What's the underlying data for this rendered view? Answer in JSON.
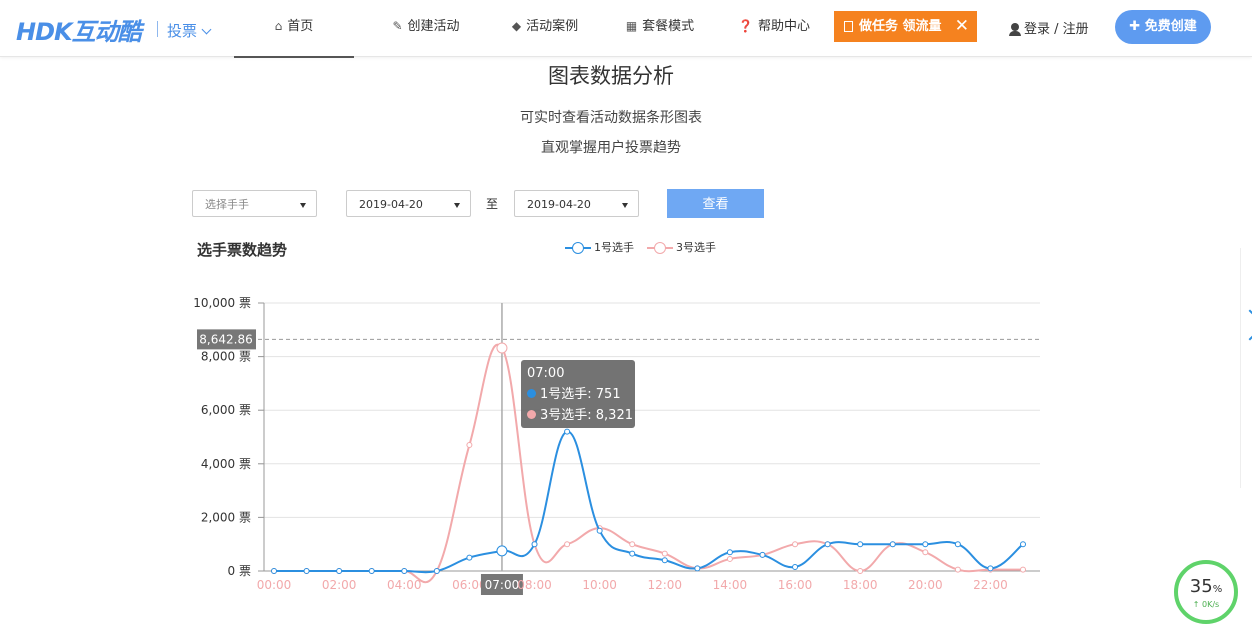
{
  "header": {
    "logo": "HDK互动酷",
    "module": "投票",
    "nav": [
      {
        "label": "首页",
        "icon": "home-icon"
      },
      {
        "label": "创建活动",
        "icon": "edit-icon"
      },
      {
        "label": "活动案例",
        "icon": "cube-icon"
      },
      {
        "label": "套餐模式",
        "icon": "grid-icon"
      },
      {
        "label": "帮助中心",
        "icon": "question-icon"
      }
    ],
    "task_button": "做任务 领流量",
    "login": "登录 / 注册",
    "free_create": "免费创建"
  },
  "section": {
    "title": "图表数据分析",
    "subtitle1": "可实时查看活动数据条形图表",
    "subtitle2": "直观掌握用户投票趋势"
  },
  "filters": {
    "player_placeholder": "选择手手",
    "start_date": "2019-04-20",
    "to_label": "至",
    "end_date": "2019-04-20",
    "query_button": "查看"
  },
  "chart_title": "选手票数趋势",
  "tooltip": {
    "time": "07:00",
    "row1": "1号选手: 751",
    "row2": "3号选手: 8,321"
  },
  "progress": {
    "value": "35",
    "unit": "%",
    "sub": "↑ 0K/s"
  },
  "colors": {
    "series1": "#2b8fe0",
    "series3": "#f2a9ab",
    "accent": "#5e9bf0",
    "task": "#f5821f"
  },
  "chart_data": {
    "type": "line",
    "x": [
      "00:00",
      "01:00",
      "02:00",
      "03:00",
      "04:00",
      "05:00",
      "06:00",
      "07:00",
      "08:00",
      "09:00",
      "10:00",
      "11:00",
      "12:00",
      "13:00",
      "14:00",
      "15:00",
      "16:00",
      "17:00",
      "18:00",
      "19:00",
      "20:00",
      "21:00",
      "22:00",
      "23:00"
    ],
    "x_tick_labels": [
      "00:00",
      "02:00",
      "04:00",
      "06:00",
      "07:00",
      "08:00",
      "10:00",
      "12:00",
      "14:00",
      "16:00",
      "18:00",
      "20:00",
      "22:00"
    ],
    "series": [
      {
        "name": "1号选手",
        "values": [
          0,
          0,
          0,
          0,
          0,
          0,
          500,
          751,
          1000,
          5200,
          1500,
          650,
          400,
          100,
          700,
          600,
          150,
          1000,
          1000,
          1000,
          1000,
          1000,
          100,
          1000
        ]
      },
      {
        "name": "3号选手",
        "values": [
          0,
          0,
          0,
          0,
          0,
          0,
          4700,
          8321,
          1000,
          1000,
          1600,
          1000,
          650,
          100,
          450,
          600,
          1000,
          1000,
          0,
          1000,
          700,
          50,
          50,
          50
        ]
      }
    ],
    "ylim": [
      0,
      10000
    ],
    "y_ticks": [
      0,
      2000,
      4000,
      6000,
      8000,
      10000
    ],
    "y_tick_labels": [
      "0 票",
      "2,000 票",
      "4,000 票",
      "6,000 票",
      "8,000 票",
      "10,000 票"
    ],
    "y_unit": "票",
    "marker_line_label": "8,642.86",
    "marker_line_value": 8642.86,
    "active_x": "07:00",
    "grid": true,
    "legend": "top-center"
  }
}
